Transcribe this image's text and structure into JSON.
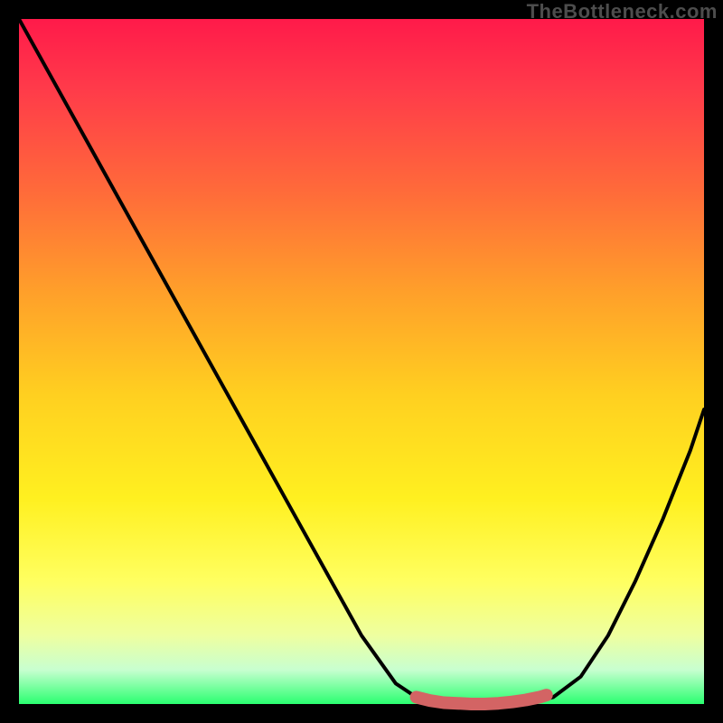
{
  "watermark": "TheBottleneck.com",
  "colors": {
    "background": "#000000",
    "gradient_top": "#ff1a4a",
    "gradient_bottom": "#2aff70",
    "curve": "#000000",
    "highlight": "#d36464",
    "watermark": "#4d4d4d"
  },
  "chart_data": {
    "type": "line",
    "title": "",
    "xlabel": "",
    "ylabel": "",
    "xlim": [
      0,
      1
    ],
    "ylim": [
      0,
      1
    ],
    "series": [
      {
        "name": "bottleneck-curve",
        "x": [
          0.0,
          0.05,
          0.1,
          0.15,
          0.2,
          0.25,
          0.3,
          0.35,
          0.4,
          0.45,
          0.5,
          0.55,
          0.58,
          0.62,
          0.66,
          0.7,
          0.74,
          0.78,
          0.82,
          0.86,
          0.9,
          0.94,
          0.98,
          1.0
        ],
        "y": [
          1.0,
          0.91,
          0.82,
          0.73,
          0.64,
          0.55,
          0.46,
          0.37,
          0.28,
          0.19,
          0.1,
          0.03,
          0.01,
          0.0,
          0.0,
          0.0,
          0.0,
          0.01,
          0.04,
          0.1,
          0.18,
          0.27,
          0.37,
          0.43
        ]
      },
      {
        "name": "highlight-segment",
        "x": [
          0.58,
          0.6,
          0.62,
          0.64,
          0.66,
          0.68,
          0.7,
          0.72,
          0.74,
          0.76,
          0.77
        ],
        "y": [
          0.01,
          0.005,
          0.002,
          0.001,
          0.0,
          0.0,
          0.001,
          0.003,
          0.006,
          0.01,
          0.013
        ]
      }
    ],
    "annotations": []
  }
}
